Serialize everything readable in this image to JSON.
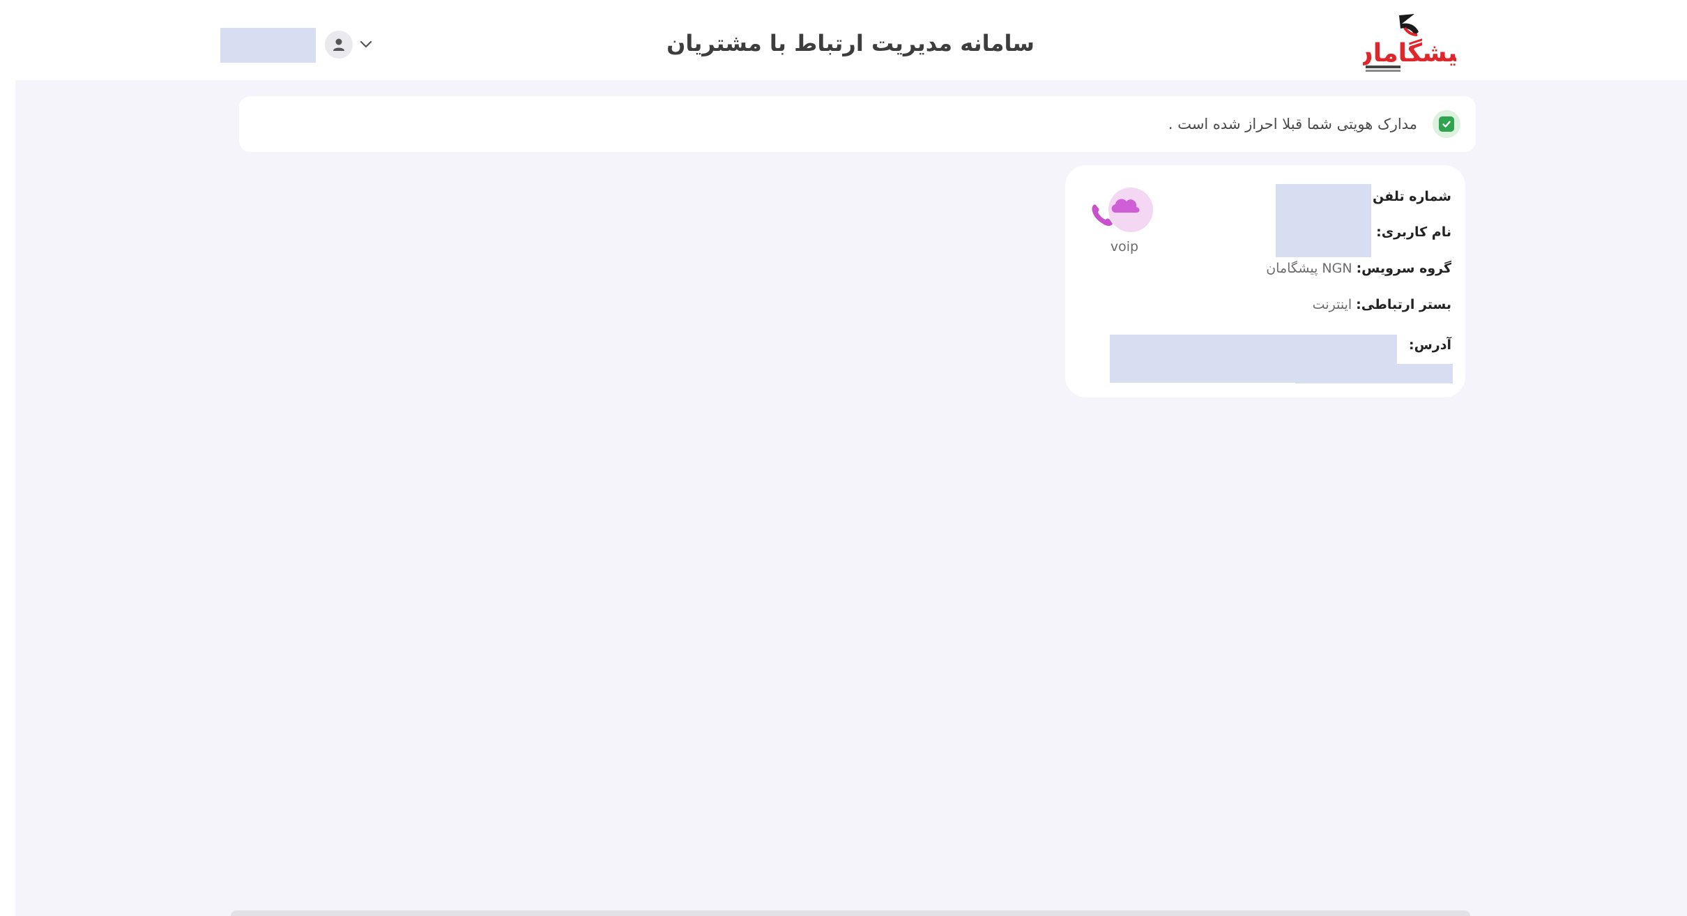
{
  "header": {
    "title": "سامانه مدیریت ارتباط با مشتریان",
    "logo_text": "پیشگامان",
    "user_name": ""
  },
  "alert": {
    "text": "مدارک هویتی شما قبلا احراز شده است ."
  },
  "service_card": {
    "phone_label": "شماره تلفن:",
    "phone_value": "",
    "username_label": "نام کاربری:",
    "username_value": "",
    "service_group_label": "گروه سرویس:",
    "service_group_value": "NGN پیشگامان",
    "connection_label": "بستر ارتباطی:",
    "connection_value": "اینترنت",
    "address_label": "آدرس:",
    "address_value": "",
    "service_type_label": "voip",
    "service_icon": "voip-phone-cloud-icon"
  },
  "colors": {
    "redaction": "#d7def1",
    "page_background": "#f5f4fa",
    "success": "#2ea44f",
    "brand_red": "#e0262b"
  }
}
